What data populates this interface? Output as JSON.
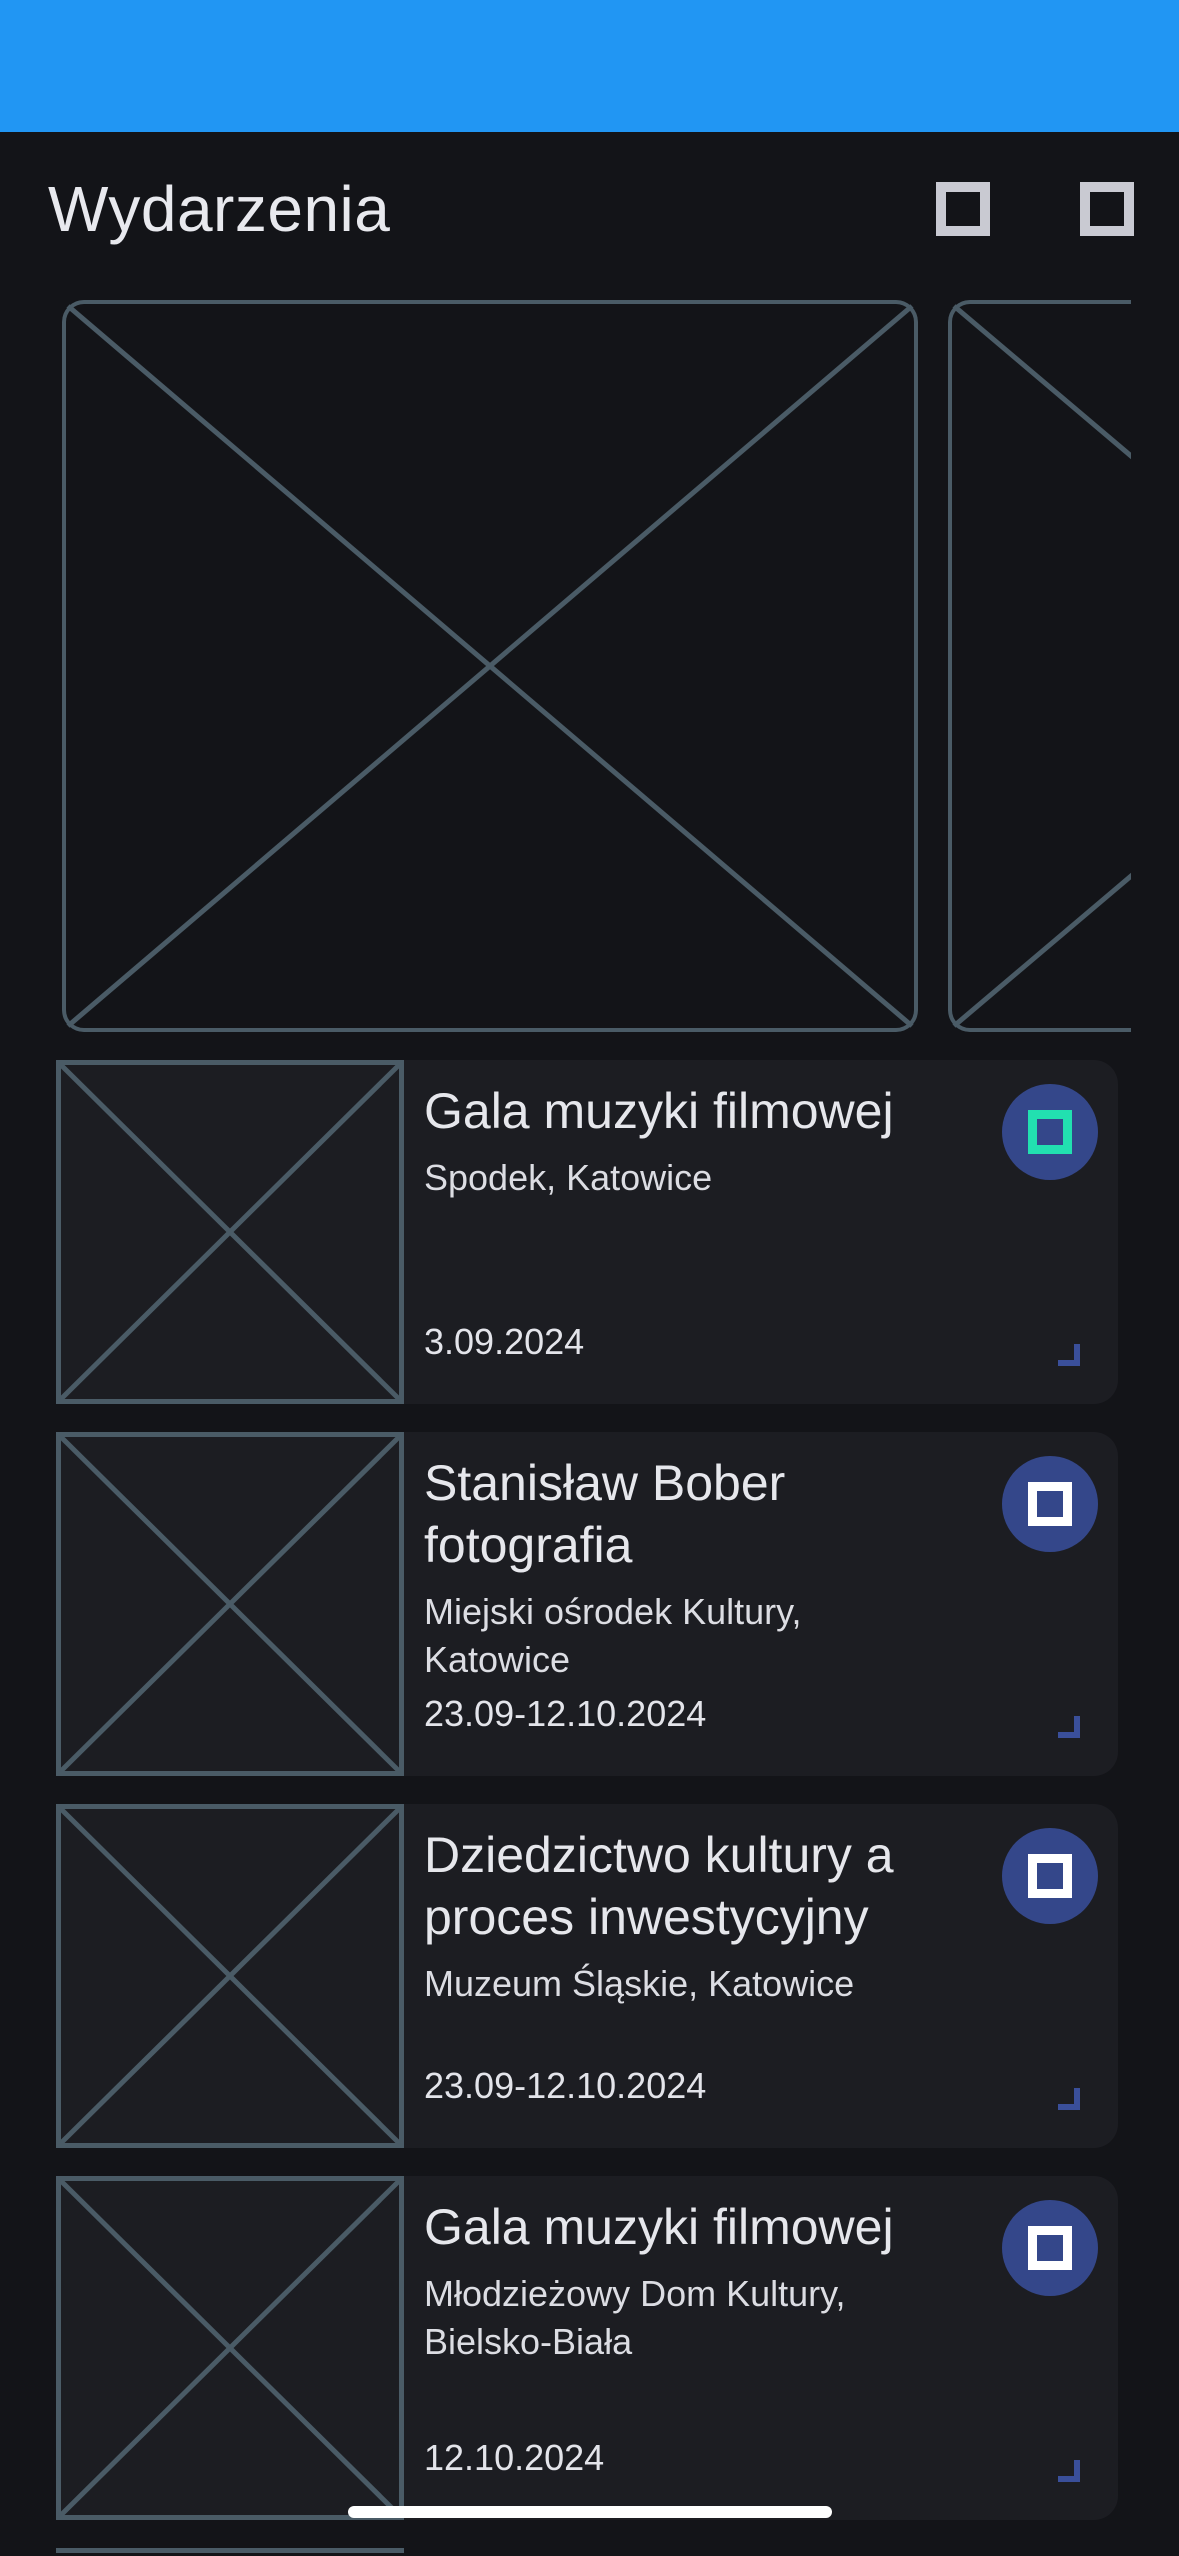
{
  "header": {
    "title": "Wydarzenia",
    "actions": [
      {
        "icon": "square-icon"
      },
      {
        "icon": "square-icon"
      }
    ]
  },
  "carousel": {
    "items": [
      {
        "image": "placeholder-image"
      },
      {
        "image": "placeholder-image"
      }
    ]
  },
  "events": [
    {
      "title": "Gala muzyki filmowej",
      "venue": "Spodek, Katowice",
      "date": "3.09.2024",
      "favorite_icon": "square-icon",
      "favorite_active": true
    },
    {
      "title": "Stanisław Bober fotografia",
      "venue": "Miejski ośrodek Kultury, Katowice",
      "date": "23.09-12.10.2024",
      "favorite_icon": "square-icon",
      "favorite_active": false
    },
    {
      "title": "Dziedzictwo kultury a proces inwestycyjny",
      "venue": "Muzeum Śląskie, Katowice",
      "date": "23.09-12.10.2024",
      "favorite_icon": "square-icon",
      "favorite_active": false
    },
    {
      "title": "Gala muzyki filmowej",
      "venue": "Młodzieżowy Dom Kultury, Bielsko-Biała",
      "date": "12.10.2024",
      "favorite_icon": "square-icon",
      "favorite_active": false
    }
  ],
  "colors": {
    "status_bar": "#2196f3",
    "background": "#131418",
    "card": "#1c1d22",
    "favorite_bg": "#34478a",
    "favorite_active": "#22e0b0",
    "placeholder_line": "#4a5b66"
  }
}
